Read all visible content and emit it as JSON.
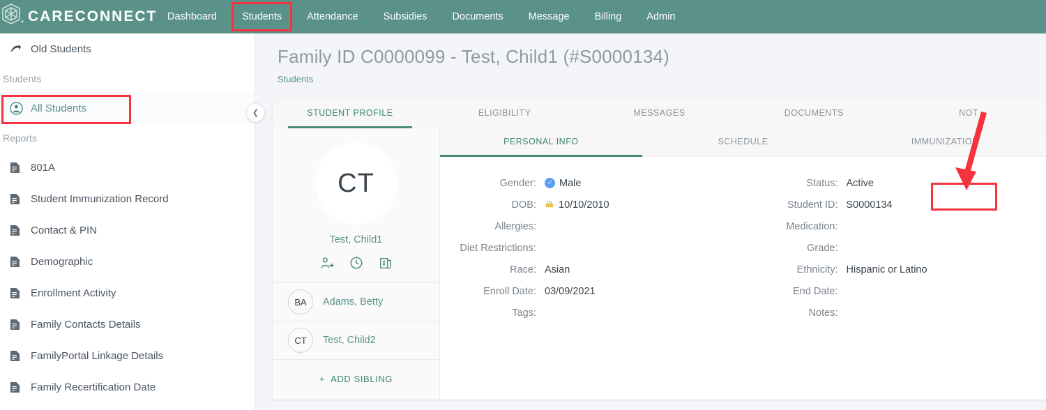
{
  "brand": {
    "name": "CARECONNECT",
    "logo_icon": "cube-logo-icon"
  },
  "topnav": {
    "items": [
      {
        "label": "Dashboard",
        "selected": false,
        "highlighted": false
      },
      {
        "label": "Students",
        "selected": true,
        "highlighted": true
      },
      {
        "label": "Attendance",
        "selected": false,
        "highlighted": false
      },
      {
        "label": "Subsidies",
        "selected": false,
        "highlighted": false
      },
      {
        "label": "Documents",
        "selected": false,
        "highlighted": false
      },
      {
        "label": "Message",
        "selected": false,
        "highlighted": false
      },
      {
        "label": "Billing",
        "selected": false,
        "highlighted": false
      },
      {
        "label": "Admin",
        "selected": false,
        "highlighted": false
      }
    ]
  },
  "sidebar": {
    "old_students": {
      "label": "Old Students",
      "icon": "arrow-forward-icon"
    },
    "students_header": "Students",
    "all_students": {
      "label": "All Students",
      "icon": "user-circle-icon"
    },
    "reports_header": "Reports",
    "reports": [
      {
        "label": "801A",
        "icon": "document-icon"
      },
      {
        "label": "Student Immunization Record",
        "icon": "document-icon"
      },
      {
        "label": "Contact & PIN",
        "icon": "document-icon"
      },
      {
        "label": "Demographic",
        "icon": "document-icon"
      },
      {
        "label": "Enrollment Activity",
        "icon": "document-icon"
      },
      {
        "label": "Family Contacts Details",
        "icon": "document-icon"
      },
      {
        "label": "FamilyPortal Linkage Details",
        "icon": "document-icon"
      },
      {
        "label": "Family Recertification Date",
        "icon": "document-icon"
      }
    ],
    "collapse_icon": "chevron-left-icon"
  },
  "page": {
    "title": "Family ID C0000099 - Test, Child1 (#S0000134)",
    "breadcrumb": "Students"
  },
  "tabs": [
    {
      "label": "STUDENT PROFILE",
      "selected": true
    },
    {
      "label": "ELIGIBILITY",
      "selected": false
    },
    {
      "label": "MESSAGES",
      "selected": false
    },
    {
      "label": "DOCUMENTS",
      "selected": false
    },
    {
      "label": "NOT",
      "selected": false
    }
  ],
  "subtabs": [
    {
      "label": "PERSONAL INFO",
      "selected": true
    },
    {
      "label": "SCHEDULE",
      "selected": false
    },
    {
      "label": "IMMUNIZATION",
      "selected": false
    }
  ],
  "profile": {
    "initials": "CT",
    "name": "Test, Child1",
    "action_icons": [
      {
        "name": "transfer-student-icon"
      },
      {
        "name": "history-clock-icon"
      },
      {
        "name": "billing-invoice-icon"
      }
    ],
    "siblings": [
      {
        "initials": "BA",
        "name": "Adams, Betty"
      },
      {
        "initials": "CT",
        "name": "Test, Child2"
      }
    ],
    "add_sibling_label": "ADD SIBLING",
    "add_sibling_icon": "plus-icon"
  },
  "personal_info": {
    "left": [
      {
        "label": "Gender:",
        "value": "Male",
        "icon": "male-gender-icon"
      },
      {
        "label": "DOB:",
        "value": "10/10/2010",
        "icon": "birthday-cake-icon"
      },
      {
        "label": "Allergies:",
        "value": ""
      },
      {
        "label": "Diet Restrictions:",
        "value": ""
      },
      {
        "label": "Race:",
        "value": "Asian"
      },
      {
        "label": "Enroll Date:",
        "value": "03/09/2021"
      },
      {
        "label": "Tags:",
        "value": ""
      }
    ],
    "right": [
      {
        "label": "Status:",
        "value": "Active"
      },
      {
        "label": "Student ID:",
        "value": "S0000134"
      },
      {
        "label": "Medication:",
        "value": ""
      },
      {
        "label": "Grade:",
        "value": ""
      },
      {
        "label": "Ethnicity:",
        "value": "Hispanic or Latino"
      },
      {
        "label": "End Date:",
        "value": ""
      },
      {
        "label": "Notes:",
        "value": ""
      }
    ]
  },
  "annotations": {
    "color": "#f5333f",
    "highlight_boxes": [
      "Students nav item",
      "All Students sidebar item",
      "Active status value"
    ],
    "arrow": "points down-left to Active status"
  },
  "colors": {
    "brand_green": "#5a9289",
    "accent_green": "#3e8575",
    "annotation_red": "#f5333f",
    "page_background": "#f4f5f8"
  }
}
